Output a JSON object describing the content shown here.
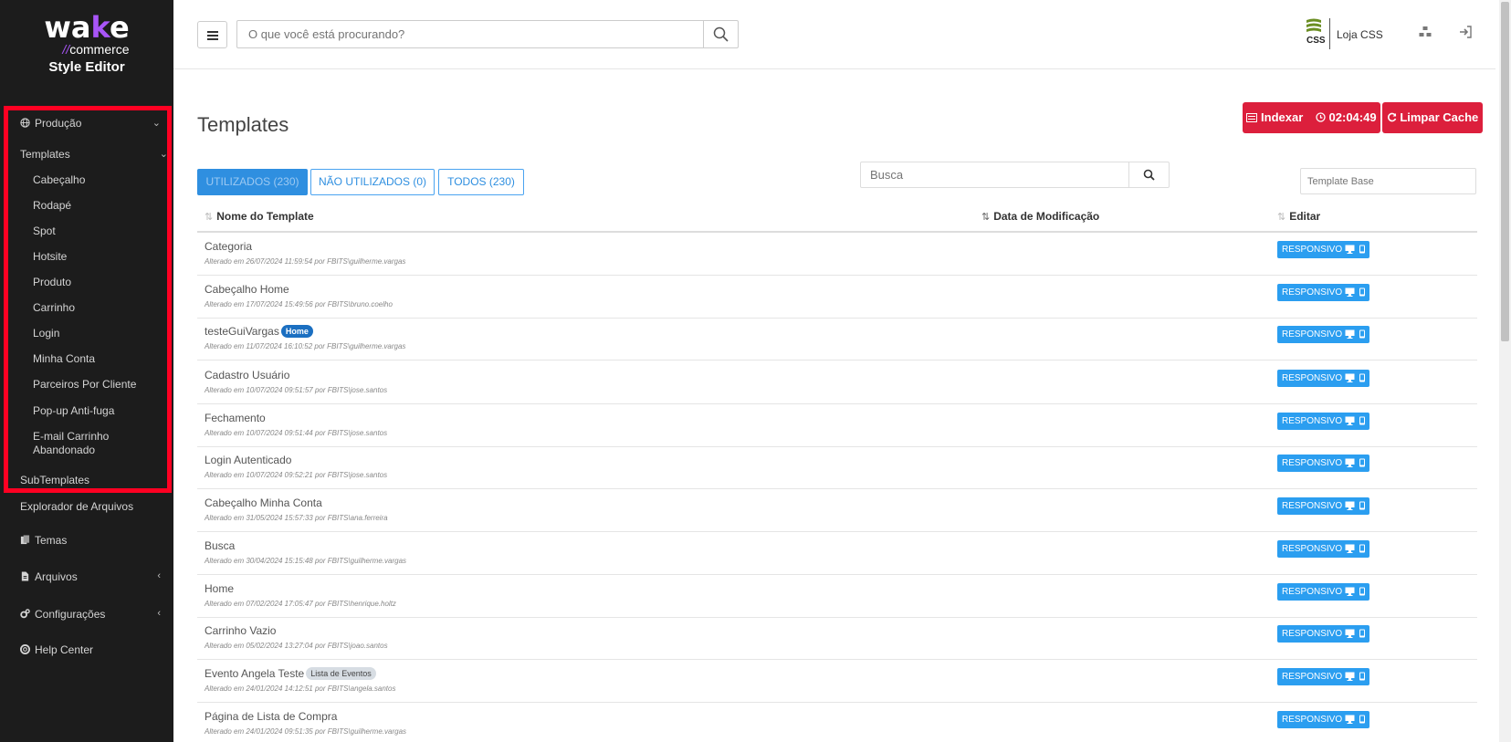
{
  "brand": {
    "wake": "wa",
    "wake_k": "k",
    "wake_e": "e",
    "slashes": "//",
    "commerce": "commerce",
    "subtitle": "Style Editor"
  },
  "sidebar": {
    "items": [
      {
        "label": "Produção",
        "icon": "globe-icon"
      },
      {
        "label": "Templates"
      },
      {
        "label": "Cabeçalho"
      },
      {
        "label": "Rodapé"
      },
      {
        "label": "Spot"
      },
      {
        "label": "Hotsite"
      },
      {
        "label": "Produto"
      },
      {
        "label": "Carrinho"
      },
      {
        "label": "Login"
      },
      {
        "label": "Minha Conta"
      },
      {
        "label": "Parceiros Por Cliente"
      },
      {
        "label": "Pop-up Anti-fuga"
      },
      {
        "label": "E-mail Carrinho"
      },
      {
        "label": "Abandonado"
      },
      {
        "label": "SubTemplates"
      },
      {
        "label": "Explorador de Arquivos"
      },
      {
        "label": "Temas",
        "icon": "files-icon"
      },
      {
        "label": "Arquivos",
        "icon": "file-icon"
      },
      {
        "label": "Configurações",
        "icon": "gears-icon"
      },
      {
        "label": "Help Center",
        "icon": "lifebuoy-icon"
      }
    ]
  },
  "header": {
    "search_placeholder": "O que você está procurando?",
    "store_logo_text": "CSS",
    "store_name": "Loja CSS"
  },
  "main": {
    "title": "Templates",
    "index_button": "Indexar",
    "timer": "02:04:49",
    "clear_cache_button": "Limpar Cache",
    "tabs": [
      "UTILIZADOS (230)",
      "NÃO UTILIZADOS (0)",
      "TODOS (230)"
    ],
    "search_placeholder": "Busca",
    "template_base_placeholder": "Template Base",
    "columns": [
      "Nome do Template",
      "Data de Modificação",
      "Editar"
    ],
    "responsive_label": "RESPONSIVO",
    "rows": [
      {
        "name": "Categoria",
        "badge": "",
        "meta": "Alterado em 26/07/2024 11:59:54 por FBITS\\guilherme.vargas"
      },
      {
        "name": "Cabeçalho Home",
        "badge": "",
        "meta": "Alterado em 17/07/2024 15:49:56 por FBITS\\bruno.coelho"
      },
      {
        "name": "testeGuiVargas",
        "badge": "Home",
        "badge_style": "blue",
        "meta": "Alterado em 11/07/2024 16:10:52 por FBITS\\guilherme.vargas"
      },
      {
        "name": "Cadastro Usuário",
        "badge": "",
        "meta": "Alterado em 10/07/2024 09:51:57 por FBITS\\jose.santos"
      },
      {
        "name": "Fechamento",
        "badge": "",
        "meta": "Alterado em 10/07/2024 09:51:44 por FBITS\\jose.santos"
      },
      {
        "name": "Login Autenticado",
        "badge": "",
        "meta": "Alterado em 10/07/2024 09:52:21 por FBITS\\jose.santos"
      },
      {
        "name": "Cabeçalho Minha Conta",
        "badge": "",
        "meta": "Alterado em 31/05/2024 15:57:33 por FBITS\\ana.ferreira"
      },
      {
        "name": "Busca",
        "badge": "",
        "meta": "Alterado em 30/04/2024 15:15:48 por FBITS\\guilherme.vargas"
      },
      {
        "name": "Home",
        "badge": "",
        "meta": "Alterado em 07/02/2024 17:05:47 por FBITS\\henrique.holtz"
      },
      {
        "name": "Carrinho Vazio",
        "badge": "",
        "meta": "Alterado em 05/02/2024 13:27:04 por FBITS\\joao.santos"
      },
      {
        "name": "Evento Angela Teste",
        "badge": "Lista de Eventos",
        "badge_style": "gray",
        "meta": "Alterado em 24/01/2024 14:12:51 por FBITS\\angela.santos"
      },
      {
        "name": "Página de Lista de Compra",
        "badge": "",
        "meta": "Alterado em 24/01/2024 09:51:35 por FBITS\\guilherme.vargas"
      }
    ]
  },
  "colors": {
    "sidebar_bg": "#1c1c1c",
    "accent_blue": "#2f8fe0",
    "red": "#dc1f3c",
    "highlight": "#ff0022",
    "brand_purple": "#a855f7"
  }
}
